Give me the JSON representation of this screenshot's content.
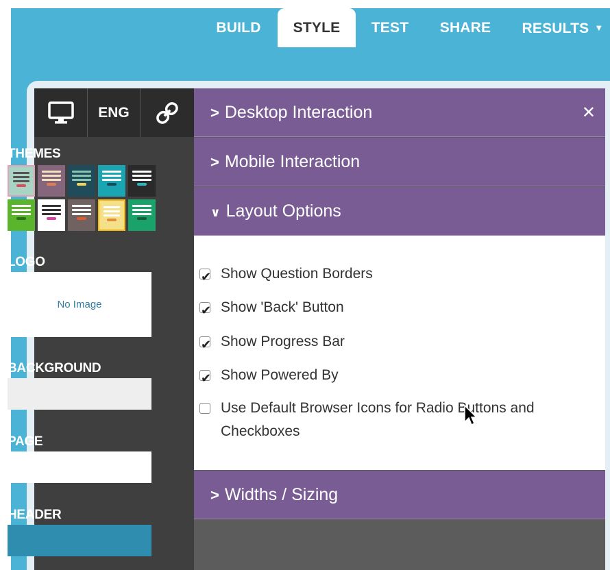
{
  "nav": {
    "items": [
      {
        "label": "BUILD"
      },
      {
        "label": "STYLE"
      },
      {
        "label": "TEST"
      },
      {
        "label": "SHARE"
      },
      {
        "label": "RESULTS"
      }
    ]
  },
  "sidebar": {
    "toolbar": {
      "desktop_icon": "monitor-icon",
      "language_label": "ENG",
      "link_icon": "link-icon"
    },
    "themes_label": "THEMES",
    "logo_label": "LOGO",
    "logo_placeholder": "No Image",
    "background_label": "BACKGROUND",
    "page_label": "PAGE",
    "header_label": "HEADER",
    "swatches": {
      "background": "#eeeeee",
      "page": "#ffffff",
      "header": "#2f8db0"
    }
  },
  "panel": {
    "sections": [
      {
        "title": "Desktop Interaction",
        "expanded": false
      },
      {
        "title": "Mobile Interaction",
        "expanded": false
      },
      {
        "title": "Layout Options",
        "expanded": true
      },
      {
        "title": "Widths / Sizing",
        "expanded": false
      }
    ],
    "layout_options": [
      {
        "label": "Show Question Borders",
        "checked": true
      },
      {
        "label": "Show 'Back' Button",
        "checked": true
      },
      {
        "label": "Show Progress Bar",
        "checked": true
      },
      {
        "label": "Show Powered By",
        "checked": true
      },
      {
        "label": "Use Default Browser Icons for Radio Buttons and Checkboxes",
        "checked": false
      }
    ],
    "close_icon": "close-icon"
  },
  "colors": {
    "app_bg": "#4ab3d6",
    "accordion": "#7a5c95",
    "sidebar": "#3f3f3f"
  }
}
